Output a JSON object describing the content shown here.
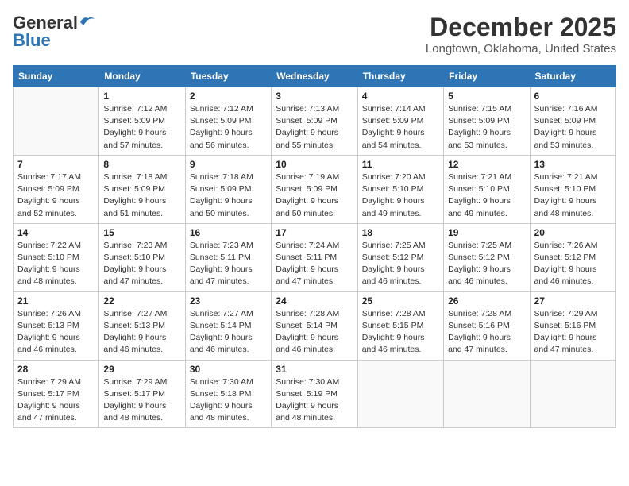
{
  "logo": {
    "line1a": "General",
    "line1b": "Blue",
    "line2": "Blue"
  },
  "header": {
    "month": "December 2025",
    "location": "Longtown, Oklahoma, United States"
  },
  "weekdays": [
    "Sunday",
    "Monday",
    "Tuesday",
    "Wednesday",
    "Thursday",
    "Friday",
    "Saturday"
  ],
  "weeks": [
    [
      {
        "day": "",
        "info": ""
      },
      {
        "day": "1",
        "info": "Sunrise: 7:12 AM\nSunset: 5:09 PM\nDaylight: 9 hours\nand 57 minutes."
      },
      {
        "day": "2",
        "info": "Sunrise: 7:12 AM\nSunset: 5:09 PM\nDaylight: 9 hours\nand 56 minutes."
      },
      {
        "day": "3",
        "info": "Sunrise: 7:13 AM\nSunset: 5:09 PM\nDaylight: 9 hours\nand 55 minutes."
      },
      {
        "day": "4",
        "info": "Sunrise: 7:14 AM\nSunset: 5:09 PM\nDaylight: 9 hours\nand 54 minutes."
      },
      {
        "day": "5",
        "info": "Sunrise: 7:15 AM\nSunset: 5:09 PM\nDaylight: 9 hours\nand 53 minutes."
      },
      {
        "day": "6",
        "info": "Sunrise: 7:16 AM\nSunset: 5:09 PM\nDaylight: 9 hours\nand 53 minutes."
      }
    ],
    [
      {
        "day": "7",
        "info": "Sunrise: 7:17 AM\nSunset: 5:09 PM\nDaylight: 9 hours\nand 52 minutes."
      },
      {
        "day": "8",
        "info": "Sunrise: 7:18 AM\nSunset: 5:09 PM\nDaylight: 9 hours\nand 51 minutes."
      },
      {
        "day": "9",
        "info": "Sunrise: 7:18 AM\nSunset: 5:09 PM\nDaylight: 9 hours\nand 50 minutes."
      },
      {
        "day": "10",
        "info": "Sunrise: 7:19 AM\nSunset: 5:09 PM\nDaylight: 9 hours\nand 50 minutes."
      },
      {
        "day": "11",
        "info": "Sunrise: 7:20 AM\nSunset: 5:10 PM\nDaylight: 9 hours\nand 49 minutes."
      },
      {
        "day": "12",
        "info": "Sunrise: 7:21 AM\nSunset: 5:10 PM\nDaylight: 9 hours\nand 49 minutes."
      },
      {
        "day": "13",
        "info": "Sunrise: 7:21 AM\nSunset: 5:10 PM\nDaylight: 9 hours\nand 48 minutes."
      }
    ],
    [
      {
        "day": "14",
        "info": "Sunrise: 7:22 AM\nSunset: 5:10 PM\nDaylight: 9 hours\nand 48 minutes."
      },
      {
        "day": "15",
        "info": "Sunrise: 7:23 AM\nSunset: 5:10 PM\nDaylight: 9 hours\nand 47 minutes."
      },
      {
        "day": "16",
        "info": "Sunrise: 7:23 AM\nSunset: 5:11 PM\nDaylight: 9 hours\nand 47 minutes."
      },
      {
        "day": "17",
        "info": "Sunrise: 7:24 AM\nSunset: 5:11 PM\nDaylight: 9 hours\nand 47 minutes."
      },
      {
        "day": "18",
        "info": "Sunrise: 7:25 AM\nSunset: 5:12 PM\nDaylight: 9 hours\nand 46 minutes."
      },
      {
        "day": "19",
        "info": "Sunrise: 7:25 AM\nSunset: 5:12 PM\nDaylight: 9 hours\nand 46 minutes."
      },
      {
        "day": "20",
        "info": "Sunrise: 7:26 AM\nSunset: 5:12 PM\nDaylight: 9 hours\nand 46 minutes."
      }
    ],
    [
      {
        "day": "21",
        "info": "Sunrise: 7:26 AM\nSunset: 5:13 PM\nDaylight: 9 hours\nand 46 minutes."
      },
      {
        "day": "22",
        "info": "Sunrise: 7:27 AM\nSunset: 5:13 PM\nDaylight: 9 hours\nand 46 minutes."
      },
      {
        "day": "23",
        "info": "Sunrise: 7:27 AM\nSunset: 5:14 PM\nDaylight: 9 hours\nand 46 minutes."
      },
      {
        "day": "24",
        "info": "Sunrise: 7:28 AM\nSunset: 5:14 PM\nDaylight: 9 hours\nand 46 minutes."
      },
      {
        "day": "25",
        "info": "Sunrise: 7:28 AM\nSunset: 5:15 PM\nDaylight: 9 hours\nand 46 minutes."
      },
      {
        "day": "26",
        "info": "Sunrise: 7:28 AM\nSunset: 5:16 PM\nDaylight: 9 hours\nand 47 minutes."
      },
      {
        "day": "27",
        "info": "Sunrise: 7:29 AM\nSunset: 5:16 PM\nDaylight: 9 hours\nand 47 minutes."
      }
    ],
    [
      {
        "day": "28",
        "info": "Sunrise: 7:29 AM\nSunset: 5:17 PM\nDaylight: 9 hours\nand 47 minutes."
      },
      {
        "day": "29",
        "info": "Sunrise: 7:29 AM\nSunset: 5:17 PM\nDaylight: 9 hours\nand 48 minutes."
      },
      {
        "day": "30",
        "info": "Sunrise: 7:30 AM\nSunset: 5:18 PM\nDaylight: 9 hours\nand 48 minutes."
      },
      {
        "day": "31",
        "info": "Sunrise: 7:30 AM\nSunset: 5:19 PM\nDaylight: 9 hours\nand 48 minutes."
      },
      {
        "day": "",
        "info": ""
      },
      {
        "day": "",
        "info": ""
      },
      {
        "day": "",
        "info": ""
      }
    ]
  ]
}
